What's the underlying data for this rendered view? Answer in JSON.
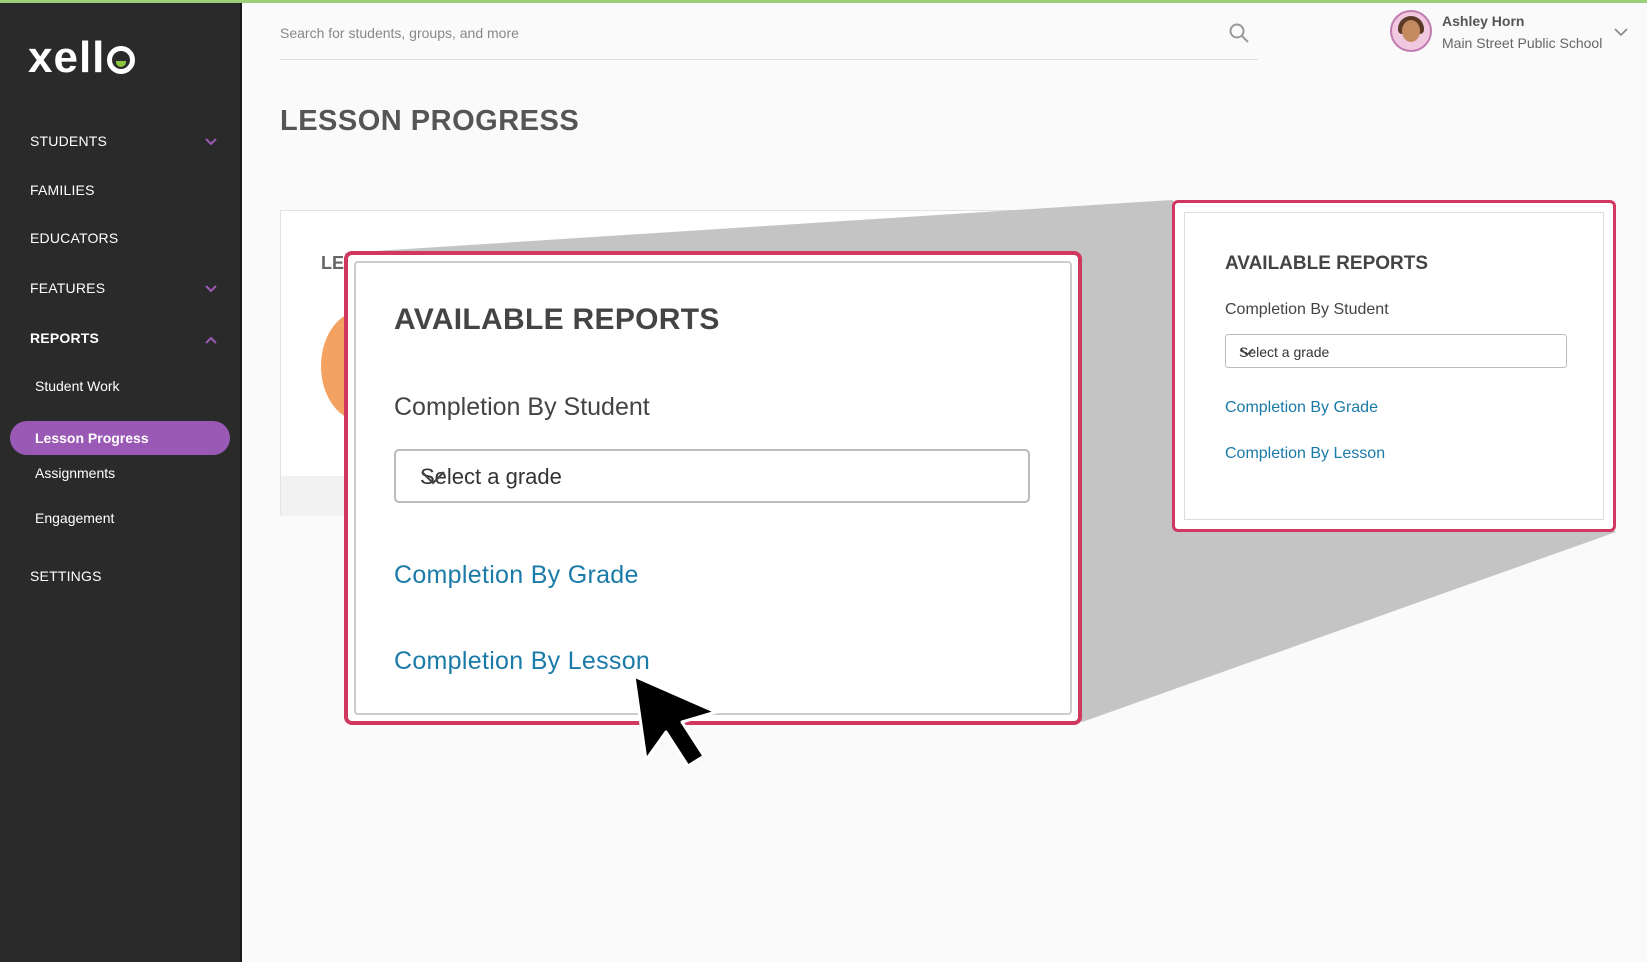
{
  "app": {
    "logo": "xello"
  },
  "sidebar": {
    "items": [
      {
        "label": "STUDENTS",
        "expandable": true,
        "expanded": false
      },
      {
        "label": "FAMILIES"
      },
      {
        "label": "EDUCATORS"
      },
      {
        "label": "FEATURES",
        "expandable": true,
        "expanded": false
      },
      {
        "label": "REPORTS",
        "expandable": true,
        "expanded": true
      },
      {
        "label": "SETTINGS"
      }
    ],
    "reports_subitems": [
      {
        "label": "Student Work"
      },
      {
        "label": "Lesson Progress",
        "active": true
      },
      {
        "label": "Assignments"
      },
      {
        "label": "Engagement"
      }
    ]
  },
  "header": {
    "search_placeholder": "Search for students, groups, and more",
    "user_name": "Ashley Horn",
    "user_school": "Main Street Public School"
  },
  "page": {
    "title": "LESSON PROGRESS",
    "bg_card_heading_fragment": "LE"
  },
  "reports_panel": {
    "title": "AVAILABLE REPORTS",
    "subtitle": "Completion By Student",
    "select_value": "Select a grade",
    "link_grade": "Completion By Grade",
    "link_lesson": "Completion By Lesson"
  },
  "colors": {
    "sidebar_bg": "#2a2a2a",
    "active_pill": "#9b59b6",
    "highlight_frame": "#d0385f",
    "link": "#1a7aa8",
    "chevron": "#9b59b6"
  }
}
